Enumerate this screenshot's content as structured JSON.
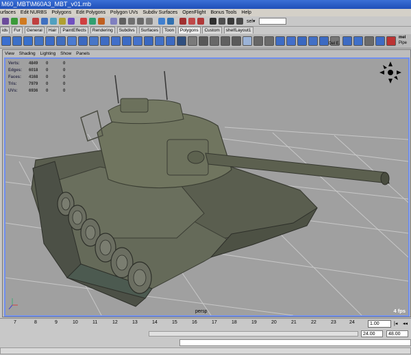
{
  "window": {
    "title": "M60_MBT\\M60A3_MBT_v01.mb"
  },
  "menubar": {
    "items": [
      "urfaces",
      "Edit NURBS",
      "Polygons",
      "Edit Polygons",
      "Polygon UVs",
      "Subdiv Surfaces",
      "OpenFlight",
      "Bonus Tools",
      "Help"
    ]
  },
  "statusline": {
    "sel_label": "sel▾",
    "sel_value": ""
  },
  "shelf": {
    "tabs": [
      "ids",
      "Fur",
      "General",
      "Hair",
      "PaintEffects",
      "Rendering",
      "Subdivs",
      "Surfaces",
      "Toon",
      "Polygons",
      "Custom",
      "shelfLayout1"
    ],
    "active_tab": "Polygons",
    "dels_label": "Del E.",
    "mel_label": "mel",
    "pipe_label": "Pipe"
  },
  "panel": {
    "menu": [
      "View",
      "Shading",
      "Lighting",
      "Show",
      "Panels"
    ],
    "camera": "persp",
    "fps": "4 fps"
  },
  "hud": [
    {
      "label": "Verts:",
      "values": [
        "4849",
        "0",
        "0"
      ]
    },
    {
      "label": "Edges:",
      "values": [
        "6018",
        "0",
        "0"
      ]
    },
    {
      "label": "Faces:",
      "values": [
        "4168",
        "0",
        "0"
      ]
    },
    {
      "label": "Tris:",
      "values": [
        "7979",
        "0",
        "0"
      ]
    },
    {
      "label": "UVs:",
      "values": [
        "6936",
        "0",
        "0"
      ]
    }
  ],
  "timeslider": {
    "ticks": [
      "7",
      "8",
      "9",
      "10",
      "11",
      "12",
      "13",
      "14",
      "15",
      "16",
      "17",
      "18",
      "19",
      "20",
      "21",
      "22",
      "23",
      "24"
    ],
    "current_frame": "1.00"
  },
  "range": {
    "end": "24.00",
    "max": "48.00"
  },
  "colors": {
    "viewport_bg": "#a0a0a0",
    "active_border": "#6f8ff0",
    "tank": "#5e6252"
  }
}
